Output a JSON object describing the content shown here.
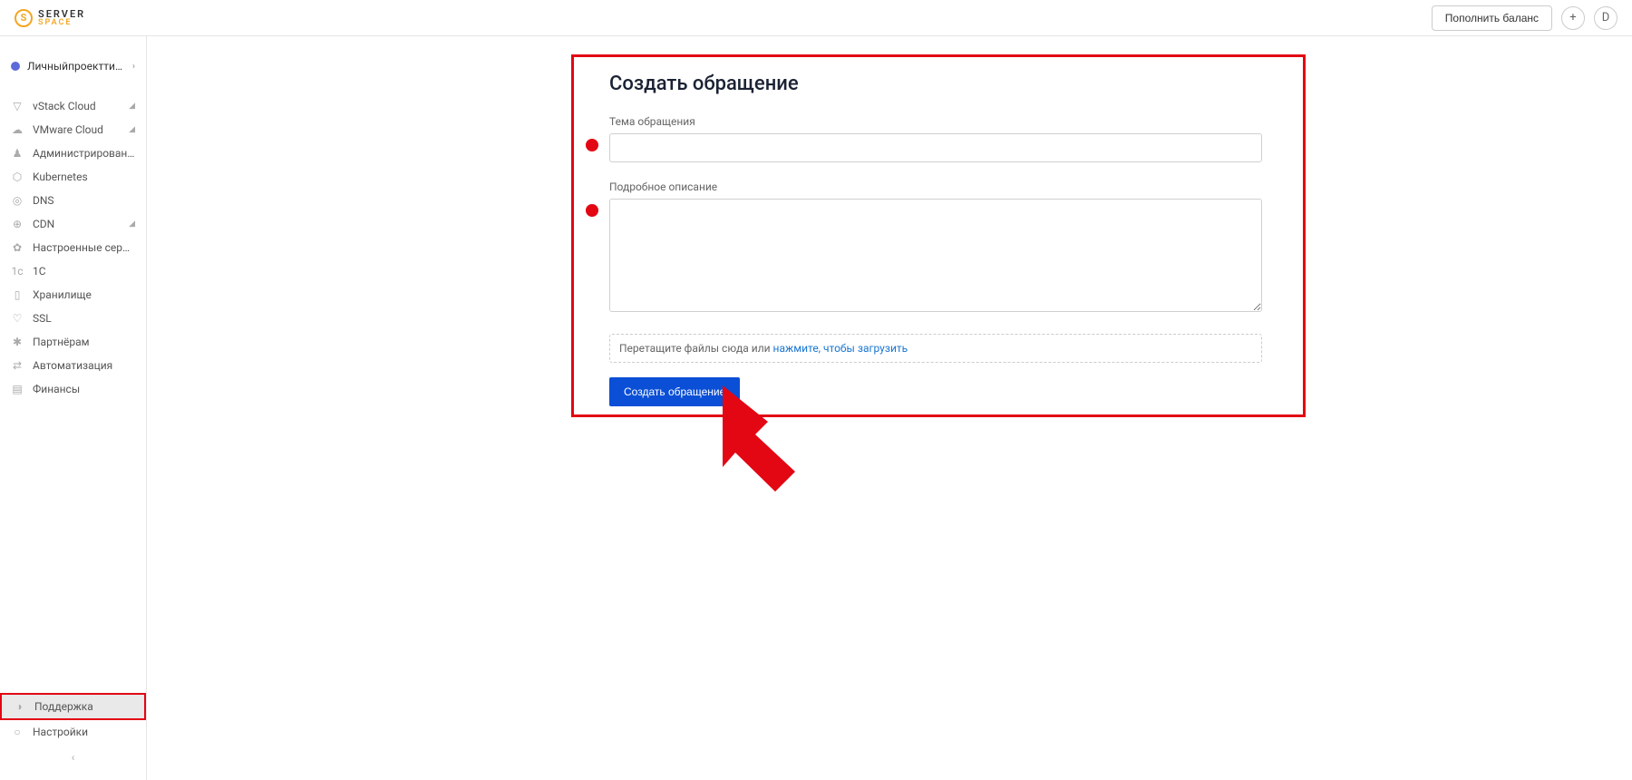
{
  "header": {
    "logo_top": "SERVER",
    "logo_bottom": "SPACE",
    "balance_button": "Пополнить баланс",
    "plus_label": "+",
    "avatar_initial": "D"
  },
  "project": {
    "name": "Личныйпроекттипот…"
  },
  "sidebar": {
    "items": [
      {
        "icon": "▽",
        "label": "vStack Cloud",
        "expandable": true
      },
      {
        "icon": "☁",
        "label": "VMware Cloud",
        "expandable": true
      },
      {
        "icon": "♟",
        "label": "Администрирование",
        "expandable": false
      },
      {
        "icon": "⬡",
        "label": "Kubernetes",
        "expandable": false
      },
      {
        "icon": "◎",
        "label": "DNS",
        "expandable": false
      },
      {
        "icon": "⊕",
        "label": "CDN",
        "expandable": true
      },
      {
        "icon": "✿",
        "label": "Настроенные серверы",
        "expandable": false
      },
      {
        "icon": "1c",
        "label": "1C",
        "expandable": false
      },
      {
        "icon": "▯",
        "label": "Хранилище",
        "expandable": false
      },
      {
        "icon": "♡",
        "label": "SSL",
        "expandable": false
      },
      {
        "icon": "✱",
        "label": "Партнёрам",
        "expandable": false
      },
      {
        "icon": "⇄",
        "label": "Автоматизация",
        "expandable": false
      },
      {
        "icon": "▤",
        "label": "Финансы",
        "expandable": false
      }
    ],
    "bottom": [
      {
        "icon": "◑",
        "label": "Поддержка",
        "active": true
      },
      {
        "icon": "○",
        "label": "Настройки",
        "active": false
      }
    ]
  },
  "form": {
    "title": "Создать обращение",
    "subject_label": "Тема обращения",
    "description_label": "Подробное описание",
    "upload_text_prefix": "Перетащите файлы сюда или ",
    "upload_link": "нажмите, чтобы загрузить",
    "submit": "Создать обращение"
  }
}
